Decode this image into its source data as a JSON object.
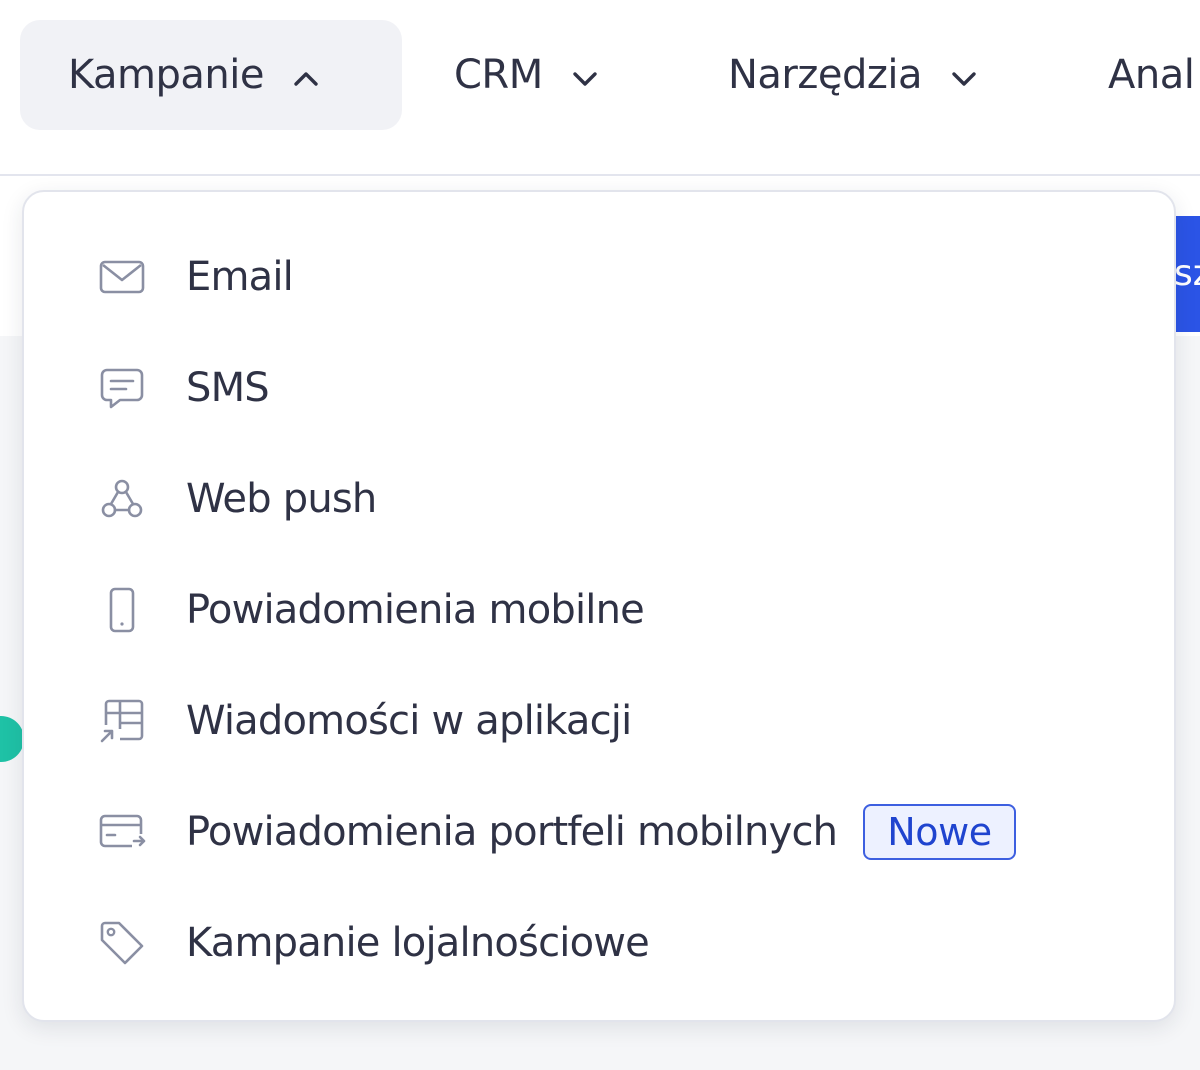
{
  "nav": {
    "items": [
      {
        "label": "Kampanie",
        "icon": "chevron-up-icon",
        "active": true
      },
      {
        "label": "CRM",
        "icon": "chevron-down-icon",
        "active": false
      },
      {
        "label": "Narzędzia",
        "icon": "chevron-down-icon",
        "active": false
      },
      {
        "label": "Anal",
        "icon": "",
        "active": false
      }
    ]
  },
  "background": {
    "button_fragment": "sz"
  },
  "dropdown": {
    "items": [
      {
        "label": "Email",
        "icon": "envelope-icon"
      },
      {
        "label": "SMS",
        "icon": "chat-bubble-icon"
      },
      {
        "label": "Web push",
        "icon": "webhook-icon"
      },
      {
        "label": "Powiadomienia mobilne",
        "icon": "smartphone-icon"
      },
      {
        "label": "Wiadomości w aplikacji",
        "icon": "app-layout-icon"
      },
      {
        "label": "Powiadomienia portfeli mobilnych",
        "icon": "wallet-card-icon",
        "badge": "Nowe"
      },
      {
        "label": "Kampanie lojalnościowe",
        "icon": "tag-icon"
      }
    ]
  },
  "colors": {
    "text": "#2f3245",
    "icon": "#8a8fa3",
    "active_tab_bg": "#f1f2f6",
    "badge_border": "#3d5fe0",
    "badge_bg": "#edf1ff",
    "badge_text": "#1f44cf",
    "accent_blue": "#2b54e6",
    "accent_teal": "#1fc2a6"
  }
}
